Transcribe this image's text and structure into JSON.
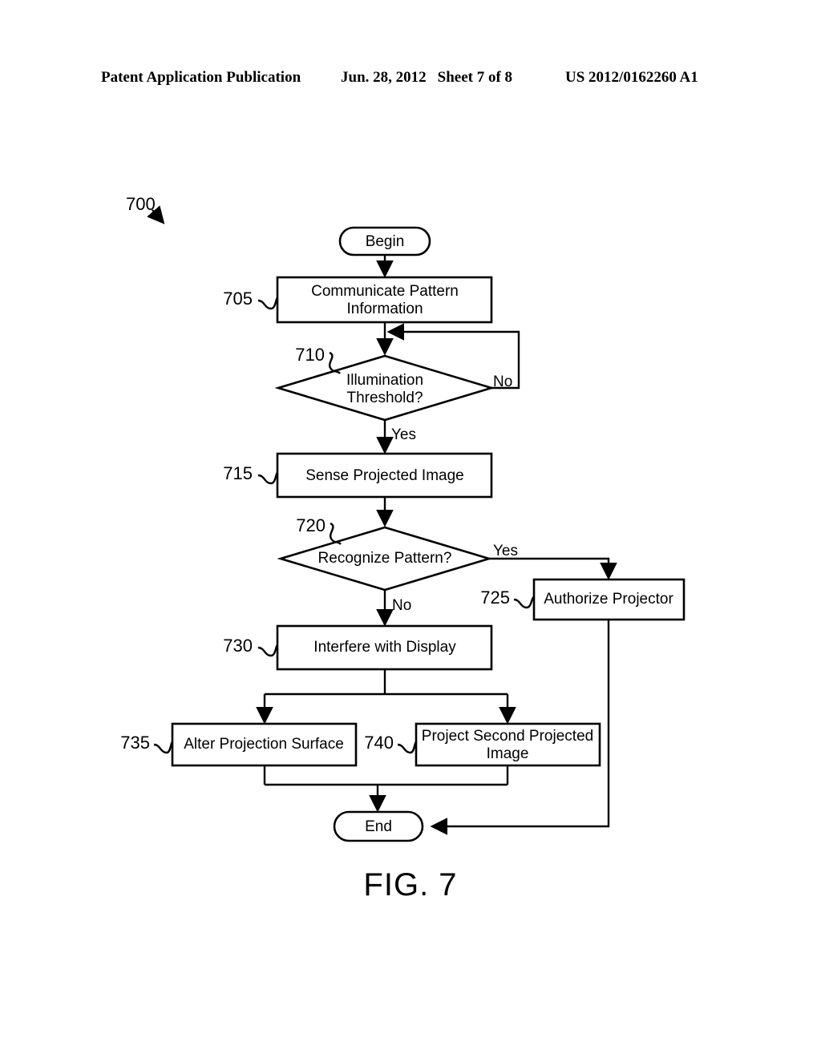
{
  "header": {
    "left": "Patent Application Publication",
    "date": "Jun. 28, 2012",
    "sheet": "Sheet 7 of 8",
    "publication_number": "US 2012/0162260 A1"
  },
  "figure": {
    "caption": "FIG. 7",
    "diagram_ref": "700"
  },
  "flowchart": {
    "type": "flowchart",
    "nodes": [
      {
        "id": "begin",
        "ref": "",
        "shape": "terminator",
        "label": "Begin"
      },
      {
        "id": "n705",
        "ref": "705",
        "shape": "process",
        "label_line1": "Communicate Pattern",
        "label_line2": "Information"
      },
      {
        "id": "n710",
        "ref": "710",
        "shape": "decision",
        "label_line1": "Illumination",
        "label_line2": "Threshold?"
      },
      {
        "id": "n715",
        "ref": "715",
        "shape": "process",
        "label_line1": "Sense Projected Image",
        "label_line2": ""
      },
      {
        "id": "n720",
        "ref": "720",
        "shape": "decision",
        "label_line1": "Recognize Pattern?",
        "label_line2": ""
      },
      {
        "id": "n725",
        "ref": "725",
        "shape": "process",
        "label_line1": "Authorize Projector",
        "label_line2": ""
      },
      {
        "id": "n730",
        "ref": "730",
        "shape": "process",
        "label_line1": "Interfere with Display",
        "label_line2": ""
      },
      {
        "id": "n735",
        "ref": "735",
        "shape": "process",
        "label_line1": "Alter Projection Surface",
        "label_line2": ""
      },
      {
        "id": "n740",
        "ref": "740",
        "shape": "process",
        "label_line1": "Project Second Projected",
        "label_line2": "Image"
      },
      {
        "id": "end",
        "ref": "",
        "shape": "terminator",
        "label": "End"
      }
    ],
    "edge_labels": {
      "n710_no": "No",
      "n710_yes": "Yes",
      "n720_yes": "Yes",
      "n720_no": "No"
    }
  }
}
